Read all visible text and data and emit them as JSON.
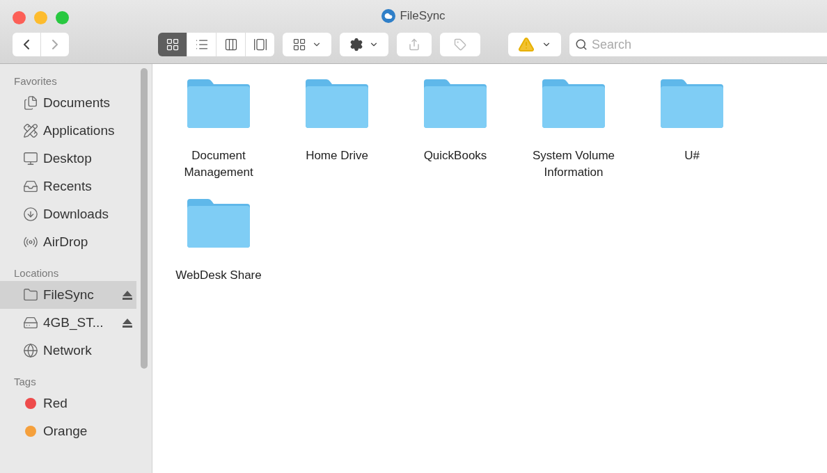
{
  "window": {
    "title": "FileSync"
  },
  "toolbar": {
    "view_modes": [
      {
        "kind": "icons",
        "selected": true
      },
      {
        "kind": "list",
        "selected": false
      },
      {
        "kind": "columns",
        "selected": false
      },
      {
        "kind": "gallery",
        "selected": false
      }
    ],
    "search": {
      "placeholder": "Search"
    }
  },
  "sidebar": {
    "sections": [
      {
        "title": "Favorites",
        "items": [
          {
            "kind": "documents",
            "label": "Documents",
            "selected": false,
            "ejectable": false
          },
          {
            "kind": "applications",
            "label": "Applications",
            "selected": false,
            "ejectable": false
          },
          {
            "kind": "desktop",
            "label": "Desktop",
            "selected": false,
            "ejectable": false
          },
          {
            "kind": "recents",
            "label": "Recents",
            "selected": false,
            "ejectable": false
          },
          {
            "kind": "downloads",
            "label": "Downloads",
            "selected": false,
            "ejectable": false
          },
          {
            "kind": "airdrop",
            "label": "AirDrop",
            "selected": false,
            "ejectable": false
          }
        ]
      },
      {
        "title": "Locations",
        "items": [
          {
            "kind": "folder",
            "label": "FileSync",
            "selected": true,
            "ejectable": true
          },
          {
            "kind": "drive",
            "label": "4GB_ST...",
            "selected": false,
            "ejectable": true
          },
          {
            "kind": "network",
            "label": "Network",
            "selected": false,
            "ejectable": false
          }
        ]
      },
      {
        "title": "Tags",
        "items": [
          {
            "kind": "tag",
            "label": "Red",
            "color": "#ee4b4b",
            "selected": false,
            "ejectable": false
          },
          {
            "kind": "tag",
            "label": "Orange",
            "color": "#f5a03c",
            "selected": false,
            "ejectable": false
          }
        ]
      }
    ]
  },
  "folders": [
    {
      "name": "Document\nManagement"
    },
    {
      "name": "Home Drive"
    },
    {
      "name": "QuickBooks"
    },
    {
      "name": "System Volume\nInformation"
    },
    {
      "name": "U#"
    },
    {
      "name": "WebDesk Share"
    }
  ]
}
